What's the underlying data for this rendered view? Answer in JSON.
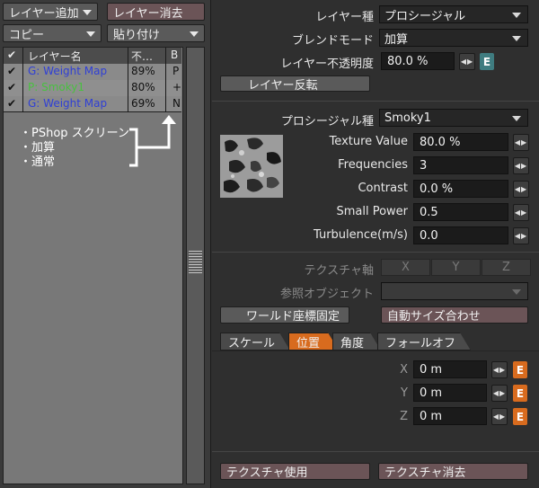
{
  "left": {
    "add_layer": "レイヤー追加",
    "delete_layer": "レイヤー消去",
    "copy": "コピー",
    "paste": "貼り付け",
    "list_headers": {
      "name": "レイヤー名",
      "opacity": "不…",
      "blend": "B"
    },
    "layers": [
      {
        "name": "G: Weight Map",
        "opacity": "89%",
        "blend": "P",
        "checked": true,
        "color": "#2f3fd6"
      },
      {
        "name": "P: Smoky1",
        "opacity": "80%",
        "blend": "+",
        "checked": true,
        "color": "#49c040"
      },
      {
        "name": "G: Weight Map",
        "opacity": "69%",
        "blend": "N",
        "checked": true,
        "color": "#2f3fd6"
      }
    ],
    "annotation_lines": [
      "・PShop スクリーン",
      "・加算",
      "・通常"
    ]
  },
  "layer": {
    "type_label": "レイヤー種",
    "type_value": "プロシージャル",
    "blend_label": "ブレンドモード",
    "blend_value": "加算",
    "opacity_label": "レイヤー不透明度",
    "opacity_value": "80.0 %",
    "invert_button": "レイヤー反転"
  },
  "procedural": {
    "type_label": "プロシージャル種",
    "type_value": "Smoky1",
    "params": [
      {
        "label": "Texture Value",
        "value": "80.0 %"
      },
      {
        "label": "Frequencies",
        "value": "3"
      },
      {
        "label": "Contrast",
        "value": "0.0 %"
      },
      {
        "label": "Small Power",
        "value": "0.5"
      },
      {
        "label": "Turbulence(m/s)",
        "value": "0.0"
      }
    ]
  },
  "texture": {
    "axis_label": "テクスチャ軸",
    "axes": [
      "X",
      "Y",
      "Z"
    ],
    "ref_object_label": "参照オブジェクト",
    "world_coords": "ワールド座標固定",
    "auto_size": "自動サイズ合わせ",
    "tabs": [
      "スケール",
      "位置",
      "角度",
      "フォールオフ"
    ],
    "position": [
      {
        "axis": "X",
        "value": "0 m"
      },
      {
        "axis": "Y",
        "value": "0 m"
      },
      {
        "axis": "Z",
        "value": "0 m"
      }
    ],
    "use_button": "テクスチャ使用",
    "delete_button": "テクスチャ消去"
  },
  "envelope_label": "E",
  "colors": {
    "accent": "#d86b1e",
    "teal": "#3f7c80"
  }
}
